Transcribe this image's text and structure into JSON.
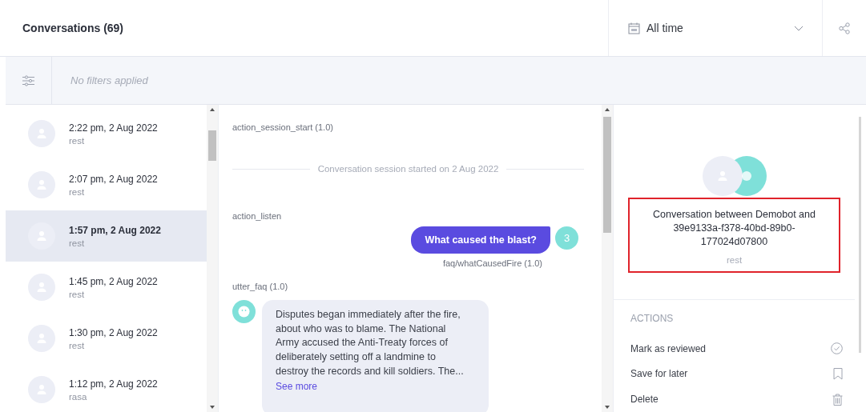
{
  "header": {
    "title": "Conversations (69)",
    "date_filter": {
      "value": "All time"
    }
  },
  "filter_bar": {
    "text": "No filters applied"
  },
  "conversations": [
    {
      "time": "2:22 pm, 2 Aug 2022",
      "channel": "rest",
      "selected": false
    },
    {
      "time": "2:07 pm, 2 Aug 2022",
      "channel": "rest",
      "selected": false
    },
    {
      "time": "1:57 pm, 2 Aug 2022",
      "channel": "rest",
      "selected": true
    },
    {
      "time": "1:45 pm, 2 Aug 2022",
      "channel": "rest",
      "selected": false
    },
    {
      "time": "1:30 pm, 2 Aug 2022",
      "channel": "rest",
      "selected": false
    },
    {
      "time": "1:12 pm, 2 Aug 2022",
      "channel": "rasa",
      "selected": false
    }
  ],
  "events": [
    {
      "kind": "action",
      "text": "action_session_start (1.0)"
    },
    {
      "kind": "divider",
      "text": "Conversation session started on 2 Aug 2022"
    },
    {
      "kind": "action",
      "text": "action_listen"
    },
    {
      "kind": "user",
      "text": "What caused the blast?",
      "badge": "3"
    },
    {
      "kind": "intent",
      "text": "faq/whatCausedFire (1.0)"
    },
    {
      "kind": "action",
      "text": "utter_faq (1.0)"
    },
    {
      "kind": "bot",
      "text": "Disputes began immediately after the fire, about who was to blame. The National Army accused the Anti-Treaty forces of deliberately setting off a landmine to destroy the records and kill soldiers. The...",
      "link": "See more"
    }
  ],
  "details": {
    "title": "Conversation between Demobot and 39e9133a-f378-40bd-89b0-177024d07800",
    "channel": "rest",
    "highlighted": true
  },
  "actions": {
    "heading": "ACTIONS",
    "items": [
      {
        "label": "Mark as reviewed",
        "kind": "check"
      },
      {
        "label": "Save for later",
        "kind": "bookmark"
      },
      {
        "label": "Delete",
        "kind": "trash"
      }
    ]
  }
}
